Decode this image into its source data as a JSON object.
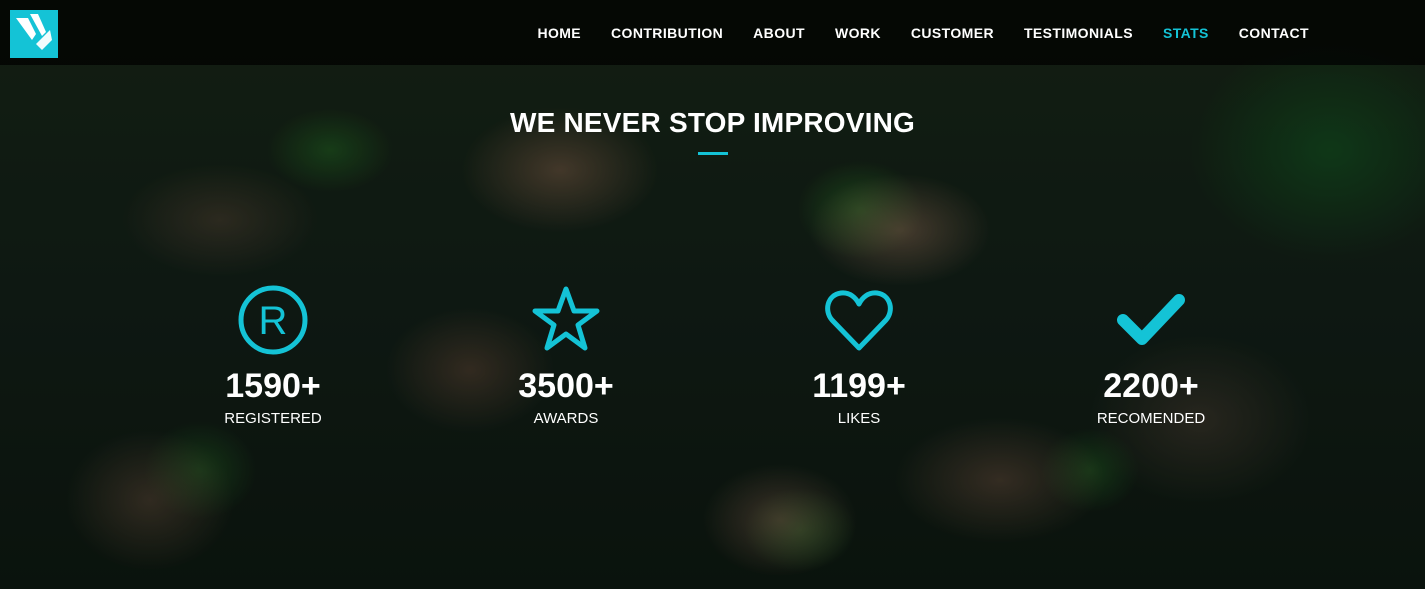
{
  "nav": {
    "items": [
      {
        "label": "HOME"
      },
      {
        "label": "CONTRIBUTION"
      },
      {
        "label": "ABOUT"
      },
      {
        "label": "WORK"
      },
      {
        "label": "CUSTOMER"
      },
      {
        "label": "TESTIMONIALS"
      },
      {
        "label": "STATS",
        "active": true
      },
      {
        "label": "CONTACT"
      }
    ]
  },
  "section": {
    "title": "WE NEVER STOP IMPROVING"
  },
  "stats": [
    {
      "icon": "registered-icon",
      "value": "1590+",
      "label": "REGISTERED"
    },
    {
      "icon": "star-icon",
      "value": "3500+",
      "label": "AWARDS"
    },
    {
      "icon": "heart-icon",
      "value": "1199+",
      "label": "LIKES"
    },
    {
      "icon": "check-icon",
      "value": "2200+",
      "label": "RECOMENDED"
    }
  ],
  "colors": {
    "accent": "#14c3d6",
    "navbar": "#000000",
    "text": "#ffffff"
  }
}
